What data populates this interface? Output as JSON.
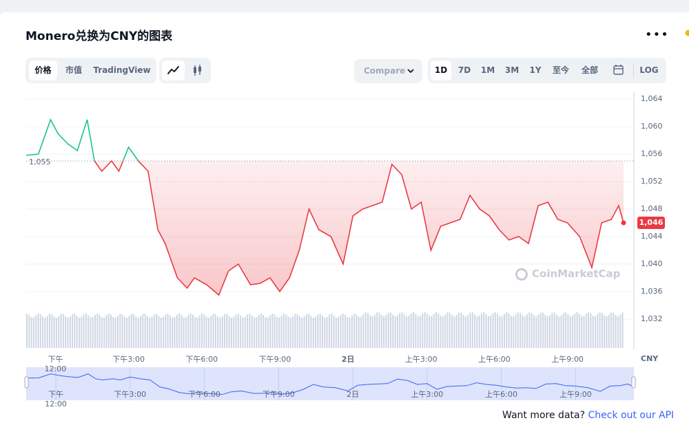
{
  "title": "Monero兑换为CNY的图表",
  "more_icon": "ellipsis-icon",
  "tabs": {
    "price": "价格",
    "market_cap": "市值",
    "tradingview": "TradingView"
  },
  "chart_types": {
    "line": "line-chart-icon",
    "candle": "candlestick-icon"
  },
  "compare": {
    "label": "Compare",
    "icon": "chevron-down-icon"
  },
  "ranges": [
    "1D",
    "7D",
    "1M",
    "3M",
    "1Y",
    "至今",
    "全部"
  ],
  "range_calendar_icon": "calendar-icon",
  "log_label": "LOG",
  "currency_label": "CNY",
  "watermark": "CoinMarketCap",
  "footer": {
    "text": "Want more data?",
    "link": "Check out our API"
  },
  "colors": {
    "up": "#16c784",
    "down": "#ea3943",
    "volume": "#cfd6e4",
    "navigator": "#dde4fb"
  },
  "chart_data": {
    "type": "line",
    "title": "Monero兑换为CNY的图表",
    "reference_value": 1055,
    "reference_label": "1,055",
    "current_price": 1046,
    "current_price_label": "1,046",
    "y_ticks": [
      "1,064",
      "1,060",
      "1,056",
      "1,052",
      "1,048",
      "1,044",
      "1,040",
      "1,036",
      "1,032"
    ],
    "y_values": [
      1064,
      1060,
      1056,
      1052,
      1048,
      1044,
      1040,
      1036,
      1032
    ],
    "ylim": [
      1032,
      1064
    ],
    "x_ticks": [
      "下午12:00",
      "下午3:00",
      "下午6:00",
      "下午9:00",
      "2日",
      "上午3:00",
      "上午6:00",
      "上午9:00"
    ],
    "x_tick_hours": [
      3,
      6,
      9,
      12,
      15,
      18,
      21,
      24
    ],
    "x_range_hours": [
      1.8,
      26.3
    ],
    "x": [
      1.8,
      2.3,
      2.8,
      3.1,
      3.5,
      3.9,
      4.3,
      4.6,
      4.9,
      5.3,
      5.6,
      6.0,
      6.4,
      6.8,
      7.2,
      7.5,
      8.0,
      8.4,
      8.7,
      9.2,
      9.7,
      10.1,
      10.5,
      11.0,
      11.4,
      11.8,
      12.2,
      12.6,
      13.0,
      13.4,
      13.8,
      14.3,
      14.8,
      15.2,
      15.6,
      16.0,
      16.4,
      16.8,
      17.2,
      17.6,
      18.0,
      18.4,
      18.8,
      19.2,
      19.6,
      20.0,
      20.4,
      20.8,
      21.2,
      21.6,
      22.0,
      22.4,
      22.8,
      23.2,
      23.6,
      24.0,
      24.5,
      25.0,
      25.4,
      25.8,
      26.1,
      26.3
    ],
    "values": [
      1055.8,
      1056.0,
      1061.0,
      1059.0,
      1057.5,
      1056.5,
      1061.0,
      1055.0,
      1053.5,
      1055.0,
      1053.5,
      1057.0,
      1055.0,
      1053.5,
      1045.0,
      1043.0,
      1038.0,
      1036.5,
      1038.0,
      1037.0,
      1035.5,
      1039.0,
      1040.0,
      1037.0,
      1037.2,
      1038.0,
      1036.0,
      1038.0,
      1042.0,
      1048.0,
      1045.0,
      1044.0,
      1040.0,
      1047.0,
      1048.0,
      1048.5,
      1049.0,
      1054.5,
      1053.0,
      1048.0,
      1049.0,
      1042.0,
      1045.5,
      1046.0,
      1046.5,
      1050.0,
      1048.0,
      1047.0,
      1045.0,
      1043.5,
      1044.0,
      1043.0,
      1048.5,
      1049.0,
      1046.5,
      1046.0,
      1044.0,
      1039.5,
      1046.0,
      1046.5,
      1048.5,
      1046.0
    ],
    "series": [
      {
        "values": "see values"
      }
    ],
    "volume": {
      "shown": true
    },
    "navigator": {
      "shown": true,
      "x_ticks": [
        "下午12:00",
        "下午3:00",
        "下午6:00",
        "下午9:00",
        "2日",
        "上午3:00",
        "上午6:00",
        "上午9:00"
      ]
    },
    "grid": true
  }
}
